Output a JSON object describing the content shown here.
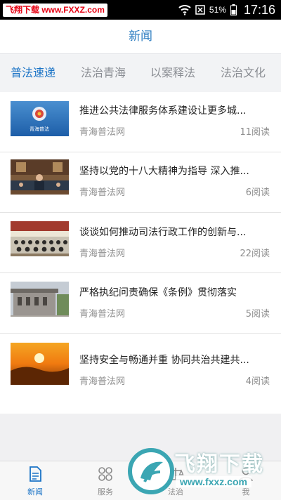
{
  "status_bar": {
    "watermark": "飞翔下载 www.FXXZ.com",
    "battery_percent": "51%",
    "time": "17:16"
  },
  "header": {
    "title": "新闻"
  },
  "tabs": [
    {
      "label": "普法速递",
      "active": true
    },
    {
      "label": "法治青海",
      "active": false
    },
    {
      "label": "以案释法",
      "active": false
    },
    {
      "label": "法治文化",
      "active": false
    }
  ],
  "news": [
    {
      "title": "推进公共法律服务体系建设让更多城...",
      "source": "青海普法网",
      "reads": "11阅读",
      "thumb_caption": "青海普法"
    },
    {
      "title": "坚持以党的十八大精神为指导 深入推...",
      "source": "青海普法网",
      "reads": "6阅读"
    },
    {
      "title": "谈谈如何推动司法行政工作的创新与...",
      "source": "青海普法网",
      "reads": "22阅读"
    },
    {
      "title": "严格执纪问责确保《条例》贯彻落实",
      "source": "青海普法网",
      "reads": "5阅读"
    },
    {
      "title": "坚持安全与畅通并重 协同共治共建共...",
      "source": "青海普法网",
      "reads": "4阅读"
    }
  ],
  "bottom_nav": [
    {
      "label": "新闻",
      "active": true,
      "icon": "document-icon"
    },
    {
      "label": "服务",
      "active": false,
      "icon": "grid-icon"
    },
    {
      "label": "法治",
      "active": false,
      "icon": "scale-icon"
    },
    {
      "label": "我",
      "active": false,
      "icon": "user-icon"
    }
  ],
  "watermark_logo": {
    "text": "飞翔下载",
    "url": "www.fxxz.com"
  },
  "colors": {
    "accent": "#1a73c6",
    "header_title": "#2a7bc0",
    "watermark_red": "#e60012"
  }
}
